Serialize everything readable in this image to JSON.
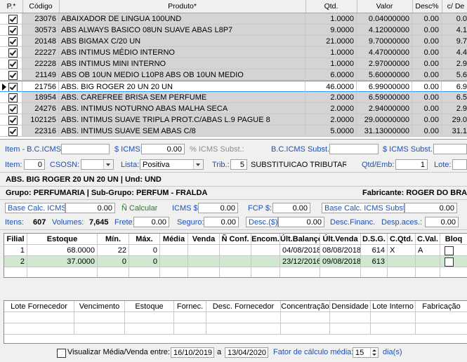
{
  "grid": {
    "columns": [
      "P.*",
      "Código",
      "Produto*",
      "Qtd.",
      "Valor",
      "Desc%",
      "c/ De"
    ],
    "rows": [
      {
        "checked": true,
        "codigo": "23076",
        "produto": "ABAIXADOR DE LINGUA 100UND",
        "qtd": "1.0000",
        "valor": "0.04000000",
        "desc": "0.00",
        "cde": "0.0",
        "selected": false
      },
      {
        "checked": true,
        "codigo": "30573",
        "produto": "ABS ALWAYS BASICO 08UN SUAVE ABAS L8P7",
        "qtd": "9.0000",
        "valor": "4.12000000",
        "desc": "0.00",
        "cde": "4.1",
        "selected": false
      },
      {
        "checked": true,
        "codigo": "20148",
        "produto": "ABS BIGMAX C/20 UN",
        "qtd": "21.0000",
        "valor": "9.70000000",
        "desc": "0.00",
        "cde": "9.7",
        "selected": false
      },
      {
        "checked": true,
        "codigo": "22227",
        "produto": "ABS INTIMUS MÉDIO INTERNO",
        "qtd": "1.0000",
        "valor": "4.47000000",
        "desc": "0.00",
        "cde": "4.4",
        "selected": false
      },
      {
        "checked": true,
        "codigo": "22228",
        "produto": "ABS INTIMUS MINI INTERNO",
        "qtd": "1.0000",
        "valor": "2.97000000",
        "desc": "0.00",
        "cde": "2.9",
        "selected": false
      },
      {
        "checked": true,
        "codigo": "21149",
        "produto": "ABS OB 10UN MEDIO L10P8 ABS OB 10UN MEDIO",
        "qtd": "6.0000",
        "valor": "5.60000000",
        "desc": "0.00",
        "cde": "5.6",
        "selected": false
      },
      {
        "checked": true,
        "codigo": "21756",
        "produto": "ABS. BIG ROGER 20 UN 20 UN",
        "qtd": "46.0000",
        "valor": "6.99000000",
        "desc": "0.00",
        "cde": "6.9",
        "selected": true
      },
      {
        "checked": true,
        "codigo": "18954",
        "produto": "ABS. CAREFREE BRISA SEM PERFUME",
        "qtd": "2.0000",
        "valor": "6.59000000",
        "desc": "0.00",
        "cde": "6.5",
        "selected": false
      },
      {
        "checked": true,
        "codigo": "24276",
        "produto": "ABS. INTIMUS NOTURNO ABAS MALHA SECA",
        "qtd": "2.0000",
        "valor": "2.94000000",
        "desc": "0.00",
        "cde": "2.9",
        "selected": false
      },
      {
        "checked": true,
        "codigo": "102125",
        "produto": "ABS. INTIMUS SUAVE  TRIPLA PROT.C/ABAS L.9 PAGUE 8",
        "qtd": "2.0000",
        "valor": "29.00000000",
        "desc": "0.00",
        "cde": "29.0",
        "selected": false
      },
      {
        "checked": true,
        "codigo": "22316",
        "produto": "ABS. INTIMUS SUAVE SEM ABAS C/8",
        "qtd": "5.0000",
        "valor": "31.13000000",
        "desc": "0.00",
        "cde": "31.1",
        "selected": false
      }
    ]
  },
  "taxes1": {
    "bc_icms_label": "Item - B.C.ICMS:",
    "bc_icms": "",
    "icms_label": "$ ICMS:",
    "icms": "0.00",
    "icms_subst_pct_label": "% ICMS Subst.:",
    "bc_icms_subst_label": "B.C.ICMS Subst.:",
    "bc_icms_subst": "",
    "icms_subst_label": "$ ICMS Subst.:",
    "icms_subst": ""
  },
  "taxes2": {
    "item_label": "Item:",
    "item": "0",
    "csosn_label": "CSOSN:",
    "csosn": "",
    "lista_label": "Lista:",
    "lista": "Positiva",
    "trib_label": "Trib.:",
    "trib": "5",
    "trib_desc": "SUBSTITUICAO TRIBUTARIA",
    "qtd_emb_label": "Qtd/Emb:",
    "qtd_emb": "1",
    "lote_label": "Lote:",
    "lote": ""
  },
  "product_info": {
    "title": "ABS. BIG ROGER 20 UN 20 UN | Und: UND",
    "group": "Grupo: PERFUMARIA | Sub-Grupo: PERFUM - FRALDA",
    "maker": "Fabricante: ROGER DO BRAS"
  },
  "totals1": {
    "base_calc_label": "Base Calc. ICMS:",
    "base_calc": "0.00",
    "nao_calcular": "Ñ Calcular",
    "icms_label": "ICMS $:",
    "icms": "0.00",
    "fcp_label": "FCP $:",
    "fcp": "0.00",
    "base_subst_label": "Base Calc. ICMS Subst.:",
    "base_subst": "0.00"
  },
  "totals2": {
    "itens_label": "Itens:",
    "itens": "607",
    "volumes_label": "Volumes:",
    "volumes": "7,645",
    "frete_label": "Frete:",
    "frete": "0.00",
    "seguro_label": "Seguro:",
    "seguro": "0.00",
    "desc_label": "Desc.($)",
    "desc": "0.00",
    "desc_financ_label": "Desc.Financ.",
    "desp_aces_label": "Desp.aces.:",
    "desp_aces": "0.00"
  },
  "branches": {
    "columns": [
      "Filial",
      "Estoque",
      "Mín.",
      "Máx.",
      "Média",
      "Venda",
      "Ñ Conf.",
      "Encom.",
      "Últ.Balanço",
      "Últ.Venda",
      "D.S.G.",
      "C.Qtd.",
      "C.Val.",
      "Bloq"
    ],
    "rows": [
      {
        "filial": "1",
        "estoque": "68.0000",
        "min": "22",
        "max": "0",
        "media": "",
        "venda": "",
        "nconf": "",
        "encom": "",
        "ult_bal": "04/08/2018",
        "ult_venda": "08/08/2018",
        "dsg": "614",
        "cqtd": "X",
        "cval": "A"
      },
      {
        "filial": "2",
        "estoque": "37.0000",
        "min": "0",
        "max": "0",
        "media": "",
        "venda": "",
        "nconf": "",
        "encom": "",
        "ult_bal": "23/12/2016",
        "ult_venda": "09/08/2018",
        "dsg": "613",
        "cqtd": "",
        "cval": ""
      }
    ]
  },
  "lots": {
    "columns": [
      "Lote Fornecedor",
      "Vencimento",
      "Estoque",
      "Fornec.",
      "Desc. Fornecedor",
      "Concentração",
      "Densidade",
      "Lote Interno",
      "Fabricação"
    ]
  },
  "footer": {
    "visualizar_label": "Visualizar Média/Venda entre:",
    "date_from": "16/10/2019",
    "a_label": "a",
    "date_to": "13/04/2020",
    "fator_label": "Fator de cálculo média:",
    "fator": "15",
    "dias_label": "dia(s)"
  }
}
